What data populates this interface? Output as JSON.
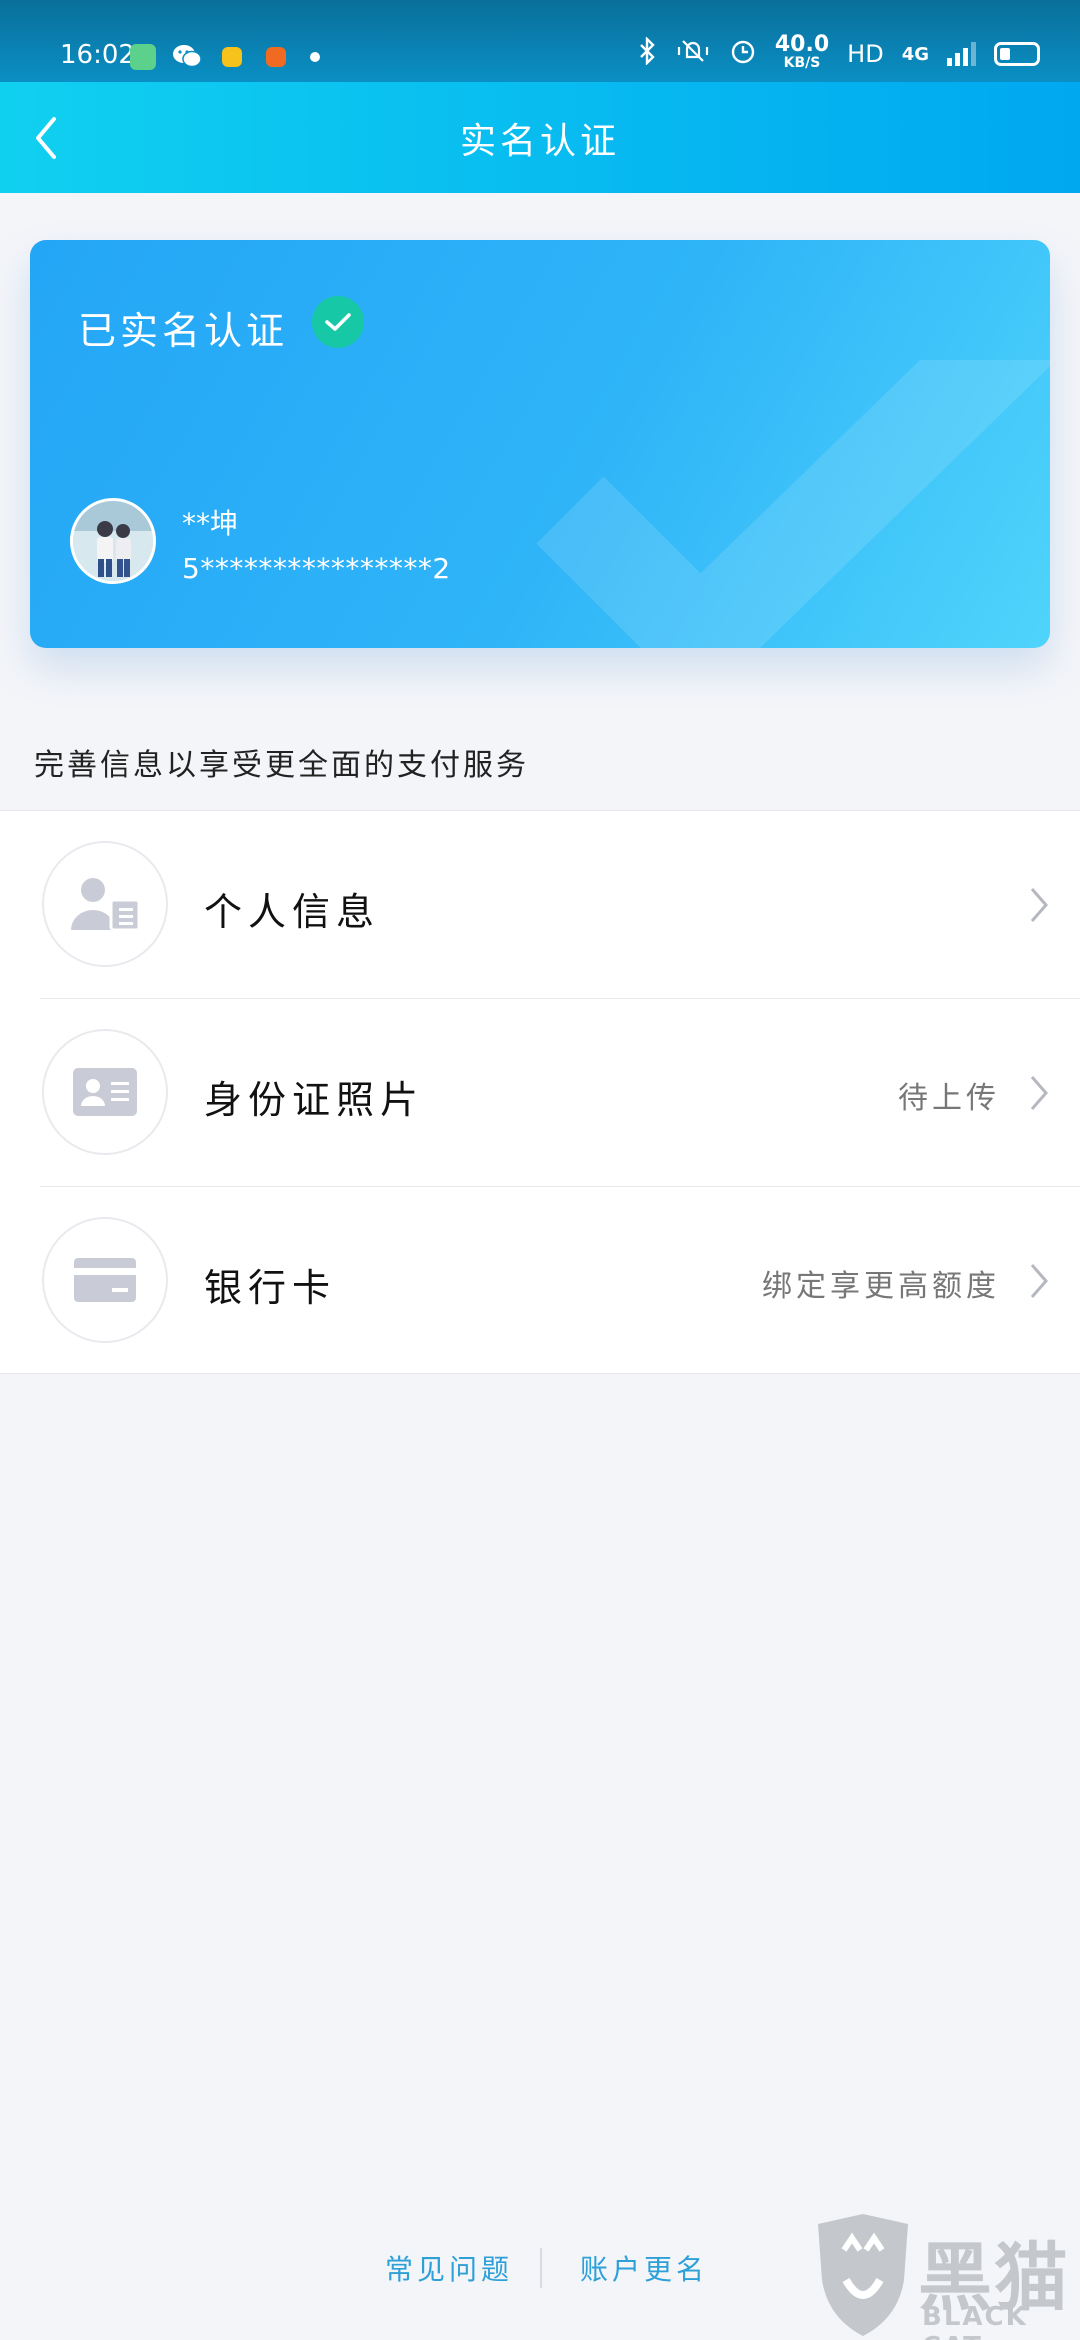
{
  "status_bar": {
    "time": "16:02",
    "network_speed": "40.0",
    "network_speed_unit": "KB/S",
    "hd_label": "HD",
    "network_type": "4G"
  },
  "header": {
    "title": "实名认证"
  },
  "card": {
    "title": "已实名认证",
    "name": "**坤",
    "id_number": "5****************2"
  },
  "hint": "完善信息以享受更全面的支付服务",
  "list": {
    "items": [
      {
        "label": "个人信息",
        "value": "",
        "icon": "personal-info-icon"
      },
      {
        "label": "身份证照片",
        "value": "待上传",
        "icon": "id-card-icon"
      },
      {
        "label": "银行卡",
        "value": "绑定享更高额度",
        "icon": "bank-card-icon"
      }
    ]
  },
  "footer": {
    "faq": "常见问题",
    "rename": "账户更名"
  },
  "watermark": {
    "cn": "黑猫",
    "en": "BLACK CAT"
  },
  "colors": {
    "accent": "#00a8f0",
    "check_green": "#16c8a6",
    "link": "#2ea0d8"
  }
}
